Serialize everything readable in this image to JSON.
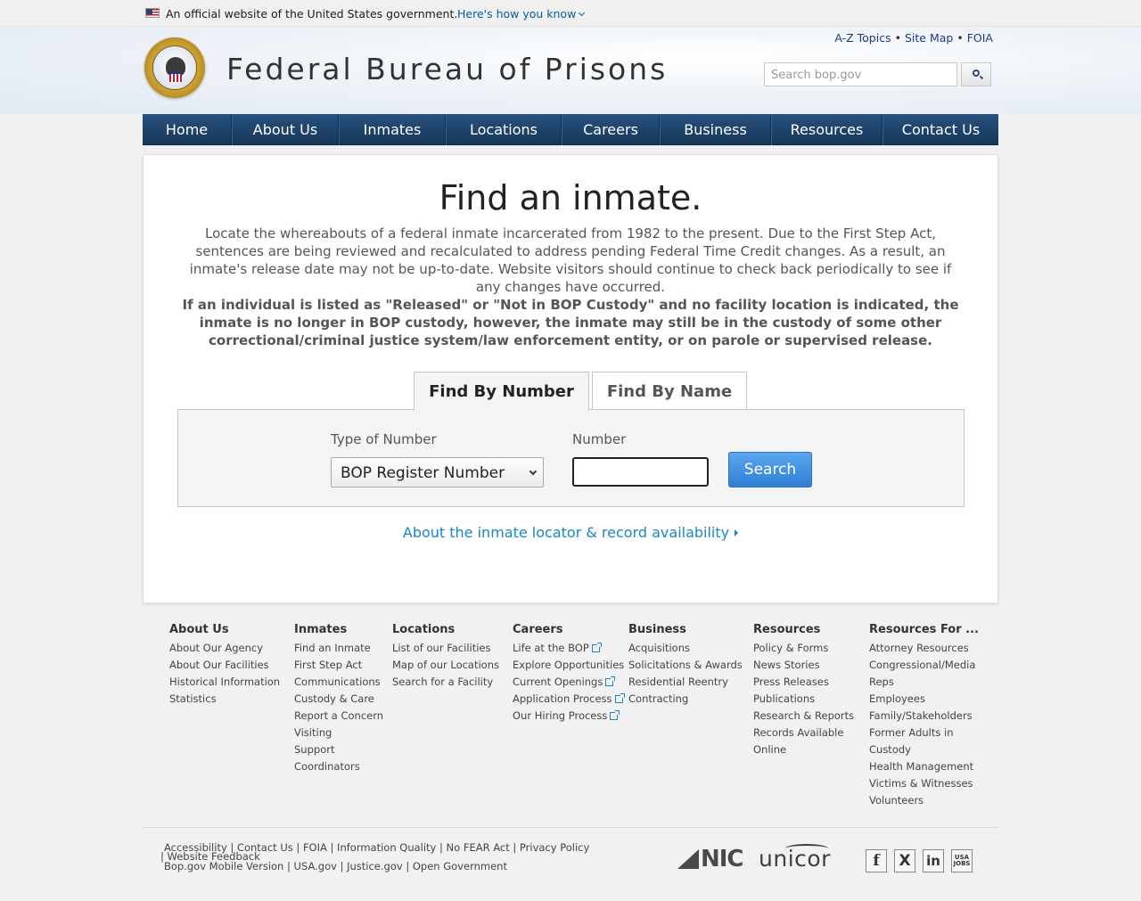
{
  "gov_banner": {
    "text": "An official website of the United States government.",
    "link": "Here's how you know"
  },
  "header": {
    "site_title": "Federal Bureau of Prisons",
    "top_links": [
      "A-Z Topics",
      "Site Map",
      "FOIA"
    ],
    "search_placeholder": "Search bop.gov"
  },
  "nav": [
    {
      "label": "Home"
    },
    {
      "label": "About Us"
    },
    {
      "label": "Inmates"
    },
    {
      "label": "Locations"
    },
    {
      "label": "Careers"
    },
    {
      "label": "Business"
    },
    {
      "label": "Resources"
    },
    {
      "label": "Contact Us"
    }
  ],
  "main": {
    "title": "Find an inmate.",
    "intro": "Locate the whereabouts of a federal inmate incarcerated from 1982 to the present. Due to the First Step Act, sentences are being reviewed and recalculated to address pending Federal Time Credit changes. As a result, an inmate's release date may not be up-to-date. Website visitors should continue to check back periodically to see if any changes have occurred.",
    "notice": "If an individual is listed as \"Released\" or \"Not in BOP Custody\" and no facility location is indicated, the inmate is no longer in BOP custody, however, the inmate may still be in the custody of some other correctional/criminal justice system/law enforcement entity, or on parole or supervised release.",
    "tabs": [
      {
        "label": "Find By Number",
        "active": true
      },
      {
        "label": "Find By Name",
        "active": false
      }
    ],
    "type_label": "Type of Number",
    "type_value": "BOP Register Number",
    "number_label": "Number",
    "number_value": "",
    "search_button": "Search",
    "locator_link": "About the inmate locator & record availability"
  },
  "footer": {
    "columns": [
      {
        "title": "About Us",
        "items": [
          "About Our Agency",
          "About Our Facilities",
          "Historical Information",
          "Statistics"
        ]
      },
      {
        "title": "Inmates",
        "items": [
          "Find an Inmate",
          "First Step Act",
          "Communications",
          "Custody & Care",
          "Report a Concern",
          "Visiting",
          "Support",
          "Coordinators"
        ]
      },
      {
        "title": "Locations",
        "items": [
          "List of our Facilities",
          "Map of our Locations",
          "Search for a Facility"
        ]
      },
      {
        "title": "Careers",
        "items": [
          "Life at the BOP",
          "Explore Opportunities",
          "Current Openings",
          "Application Process",
          "Our Hiring Process"
        ]
      },
      {
        "title": "Business",
        "items": [
          "Acquisitions",
          "Solicitations & Awards",
          "Residential Reentry",
          "Contracting"
        ]
      },
      {
        "title": "Resources",
        "items": [
          "Policy & Forms",
          "News Stories",
          "Press Releases",
          "Publications",
          "Research & Reports",
          "Records Available",
          "Online"
        ]
      },
      {
        "title": "Resources For ...",
        "items": [
          "Attorney Resources",
          "Congressional/Media",
          "Reps",
          "Employees",
          "Family/Stakeholders",
          "Former Adults in",
          "Custody",
          "Health Management",
          "Victims & Witnesses",
          "Volunteers"
        ]
      }
    ],
    "bottom_row1": "Accessibility | Contact Us | FOIA | Information Quality | No FEAR Act | Privacy Policy",
    "bottom_row2": "| Website Feedback",
    "bottom_row3": "Bop.gov Mobile Version | USA.gov | Justice.gov | Open Government",
    "nic_logo": "NIC",
    "unicor_logo": "unicor",
    "social": {
      "facebook": "f",
      "x": "X",
      "linkedin": "in",
      "usajobs": "USA JOBS"
    }
  }
}
